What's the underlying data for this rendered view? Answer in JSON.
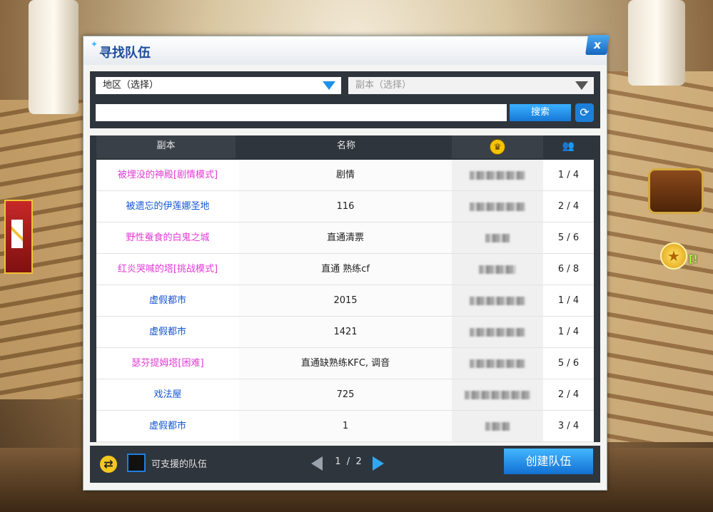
{
  "window": {
    "title": "寻找队伍",
    "close_label": "x"
  },
  "filters": {
    "region": "地区（选择）",
    "dungeon": "副本（选择）",
    "search_value": "",
    "search_label": "搜索"
  },
  "table": {
    "headers": {
      "dungeon": "副本",
      "name": "名称"
    },
    "rows": [
      {
        "dungeon": "被埋没的神殿[剧情模式]",
        "name": "剧情",
        "count": "1 / 4",
        "color": "pink"
      },
      {
        "dungeon": "被遗忘的伊莲娜圣地",
        "name": "116",
        "count": "2 / 4",
        "color": "blue"
      },
      {
        "dungeon": "野性蚕食的白鬼之城",
        "name": "直通清票",
        "count": "5 / 6",
        "color": "pink"
      },
      {
        "dungeon": "红炎哭喊的塔[挑战模式]",
        "name": "直通 熟练cf",
        "count": "6 / 8",
        "color": "pink"
      },
      {
        "dungeon": "虚假都市",
        "name": "2015",
        "count": "1 / 4",
        "color": "blue"
      },
      {
        "dungeon": "虚假都市",
        "name": "1421",
        "count": "1 / 4",
        "color": "blue"
      },
      {
        "dungeon": "瑟芬提姆塔[困难]",
        "name": "直通缺熟练KFC, 调音",
        "count": "5 / 6",
        "color": "pink"
      },
      {
        "dungeon": "戏法屋",
        "name": "725",
        "count": "2 / 4",
        "color": "blue"
      },
      {
        "dungeon": "虚假都市",
        "name": "1",
        "count": "3 / 4",
        "color": "blue"
      }
    ]
  },
  "footer": {
    "supportable_label": "可支援的队伍",
    "page_current": "1",
    "page_sep": "/",
    "page_total": "2",
    "create_label": "创建队伍"
  },
  "colors": {
    "pink": "#e23bd6",
    "blue": "#1456d4",
    "accent": "#1e90e8"
  },
  "icons": [
    "crown-icon",
    "people-icon",
    "refresh-icon",
    "cycle-icon",
    "close-icon",
    "star-icon",
    "chest-icon"
  ]
}
